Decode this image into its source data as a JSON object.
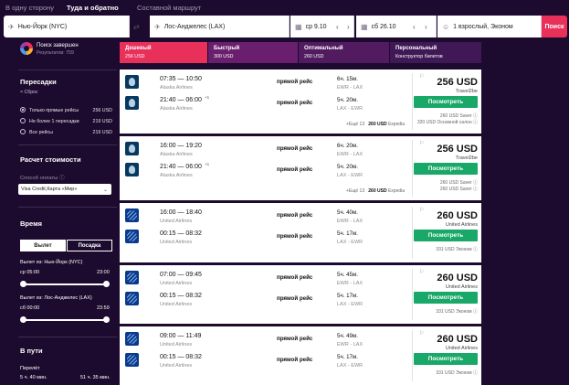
{
  "trip_tabs": [
    "В одну сторону",
    "Туда и обратно",
    "Составной маршрут"
  ],
  "search": {
    "origin": "Нью-Йорк (NYC)",
    "destination": "Лос-Анджелес (LAX)",
    "depart": "ср 9.10",
    "return": "сб 26.10",
    "passengers": "1 взрослый, Эконом",
    "button": "Поиск"
  },
  "sidebar": {
    "status_title": "Поиск завершен",
    "status_sub": "Результатов: 759",
    "stops_title": "Пересадки",
    "reset": "Сброс",
    "stops": [
      {
        "label": "Только прямые рейсы",
        "price": "256 USD",
        "selected": true
      },
      {
        "label": "Не более 1 пересадки",
        "price": "219 USD",
        "selected": false
      },
      {
        "label": "Все рейсы",
        "price": "219 USD",
        "selected": false
      }
    ],
    "cost_title": "Расчет стоимости",
    "pay_label": "Способ оплаты",
    "pay_value": "Visa Credit,Карта «Мир»",
    "time_title": "Время",
    "seg_depart": "Вылет",
    "seg_arrive": "Посадка",
    "slider1_label": "Вылет из: Нью-Йорк (NYC)",
    "slider1_from": "ср 05:00",
    "slider1_to": "23:00",
    "slider2_label": "Вылет из: Лос-Анджелес (LAX)",
    "slider2_from": "сб 00:00",
    "slider2_to": "23:59",
    "journey_title": "В пути",
    "flight_label": "Перелёт",
    "flight_from": "5 ч. 40 мин.",
    "flight_to": "51 ч. 35 мин."
  },
  "sort_tabs": [
    {
      "title": "Дешевый",
      "sub": "256 USD",
      "color": "#e8305a"
    },
    {
      "title": "Быстрый",
      "sub": "300 USD",
      "color": "#6a1f6e"
    },
    {
      "title": "Оптимальный",
      "sub": "260 USD",
      "color": "#521b60"
    },
    {
      "title": "Персональный",
      "sub": "Конструктор билетов",
      "color": "#3f1855"
    }
  ],
  "results": [
    {
      "airline": "alaska",
      "legs": [
        {
          "times": "07:35 — 10:50",
          "plus": "",
          "carrier": "Alaska Airlines",
          "stops": "прямой рейс",
          "dur": "6ч. 15м.",
          "route": "EWR - LAX"
        },
        {
          "times": "21:40 — 06:00",
          "plus": "+1",
          "carrier": "Alaska Airlines",
          "stops": "прямой рейс",
          "dur": "5ч. 20м.",
          "route": "LAX - EWR"
        }
      ],
      "more": "Ещё 13",
      "more_price": "260 USD",
      "more_vendor": "Expedia",
      "price": "256 USD",
      "vendor": "Travel2be",
      "button": "Посмотреть",
      "extras": [
        "260 USD Saver",
        "320 USD Основной салон"
      ]
    },
    {
      "airline": "alaska",
      "legs": [
        {
          "times": "16:00 — 19:20",
          "plus": "",
          "carrier": "Alaska Airlines",
          "stops": "прямой рейс",
          "dur": "6ч. 20м.",
          "route": "EWR - LAX"
        },
        {
          "times": "21:40 — 06:00",
          "plus": "+1",
          "carrier": "Alaska Airlines",
          "stops": "прямой рейс",
          "dur": "5ч. 20м.",
          "route": "LAX - EWR"
        }
      ],
      "more": "Ещё 13",
      "more_price": "260 USD",
      "more_vendor": "Expedia",
      "price": "256 USD",
      "vendor": "Travel2be",
      "button": "Посмотреть",
      "extras": [
        "260 USD Saver",
        "260 USD Saver"
      ]
    },
    {
      "airline": "united",
      "legs": [
        {
          "times": "16:00 — 18:40",
          "plus": "",
          "carrier": "United Airlines",
          "stops": "прямой рейс",
          "dur": "5ч. 40м.",
          "route": "EWR - LAX"
        },
        {
          "times": "00:15 — 08:32",
          "plus": "",
          "carrier": "United Airlines",
          "stops": "прямой рейс",
          "dur": "5ч. 17м.",
          "route": "LAX - EWR"
        }
      ],
      "more": "",
      "more_price": "",
      "more_vendor": "",
      "price": "260 USD",
      "vendor": "United Airlines",
      "button": "Посмотреть",
      "extras": [
        "331 USD Эконом"
      ]
    },
    {
      "airline": "united",
      "legs": [
        {
          "times": "07:00 — 09:45",
          "plus": "",
          "carrier": "United Airlines",
          "stops": "прямой рейс",
          "dur": "5ч. 45м.",
          "route": "EWR - LAX"
        },
        {
          "times": "00:15 — 08:32",
          "plus": "",
          "carrier": "United Airlines",
          "stops": "прямой рейс",
          "dur": "5ч. 17м.",
          "route": "LAX - EWR"
        }
      ],
      "more": "",
      "more_price": "",
      "more_vendor": "",
      "price": "260 USD",
      "vendor": "United Airlines",
      "button": "Посмотреть",
      "extras": [
        "331 USD Эконом"
      ]
    },
    {
      "airline": "united",
      "legs": [
        {
          "times": "09:00 — 11:49",
          "plus": "",
          "carrier": "United Airlines",
          "stops": "прямой рейс",
          "dur": "5ч. 49м.",
          "route": "EWR - LAX"
        },
        {
          "times": "00:15 — 08:32",
          "plus": "",
          "carrier": "United Airlines",
          "stops": "прямой рейс",
          "dur": "5ч. 17м.",
          "route": "LAX - EWR"
        }
      ],
      "more": "",
      "more_price": "",
      "more_vendor": "",
      "price": "260 USD",
      "vendor": "United Airlines",
      "button": "Посмотреть",
      "extras": [
        "331 USD Эконом"
      ]
    }
  ]
}
